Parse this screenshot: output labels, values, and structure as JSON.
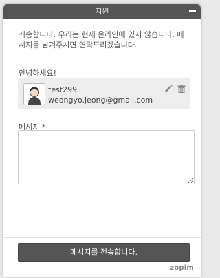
{
  "window": {
    "title": "지원",
    "minimize_icon": "minimize-icon"
  },
  "offline_message": "죄송합니다. 우리는 현재 온라인에 있지 않습니다. 메시지를 남겨주시면 연락드리겠습니다.",
  "greeting": "안녕하세요!",
  "user": {
    "name": "test299",
    "email": "weongyo.jeong@gmail.com",
    "avatar_icon": "user-avatar-icon",
    "edit_icon": "pencil-icon",
    "delete_icon": "trash-icon"
  },
  "message_field": {
    "label": "메시지 *",
    "value": ""
  },
  "send_button_label": "메시지를 전송합니다.",
  "brand": "zopim",
  "colors": {
    "titlebar": "#555555",
    "button": "#555555",
    "card": "#ededed"
  }
}
